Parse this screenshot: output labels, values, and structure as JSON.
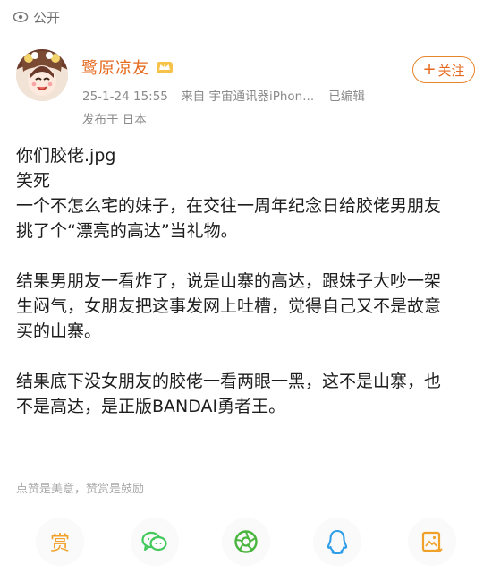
{
  "top_bar": {
    "visibility_label": "公开",
    "icon": "eye-icon"
  },
  "post": {
    "author": "鹭原凉友",
    "badge_icon": "vip-crown-icon",
    "date": "25-1-24 15:55",
    "source": "来自 宇宙通讯器iPhon...",
    "edited": "已编辑",
    "published_from": "发布于 日本",
    "follow_label": "关注",
    "content": [
      "你们胶佬.jpg",
      "笑死",
      "一个不怎么宅的妹子，在交往一周年纪念日给胶佬男朋友",
      "挑了个“漂亮的高达”当礼物。",
      "",
      "结果男朋友一看炸了，说是山寨的高达，跟妹子大吵一架",
      "生闷气，女朋友把这事发网上吐槽，觉得自己又不是故意",
      "买的山寨。",
      "",
      "结果底下没女朋友的胶佬一看两眼一黑，这不是山寨，也",
      "不是高达，是正版BANDAI勇者王。"
    ],
    "reward_hint": "点赞是美意，赞赏是鼓励"
  },
  "actions": [
    {
      "name": "reward",
      "label": "赏",
      "icon": "reward-icon"
    },
    {
      "name": "wechat",
      "icon": "wechat-icon"
    },
    {
      "name": "moments",
      "icon": "moments-icon"
    },
    {
      "name": "qq",
      "icon": "qq-icon"
    },
    {
      "name": "save-image",
      "icon": "save-image-icon"
    }
  ],
  "colors": {
    "accent": "#e46a1f",
    "secondary": "#8a8a8a",
    "reward": "#f0a12a",
    "wechat": "#42c85b",
    "moments": "#4ab640",
    "qq": "#2f9ee8",
    "save": "#f0a12a"
  }
}
